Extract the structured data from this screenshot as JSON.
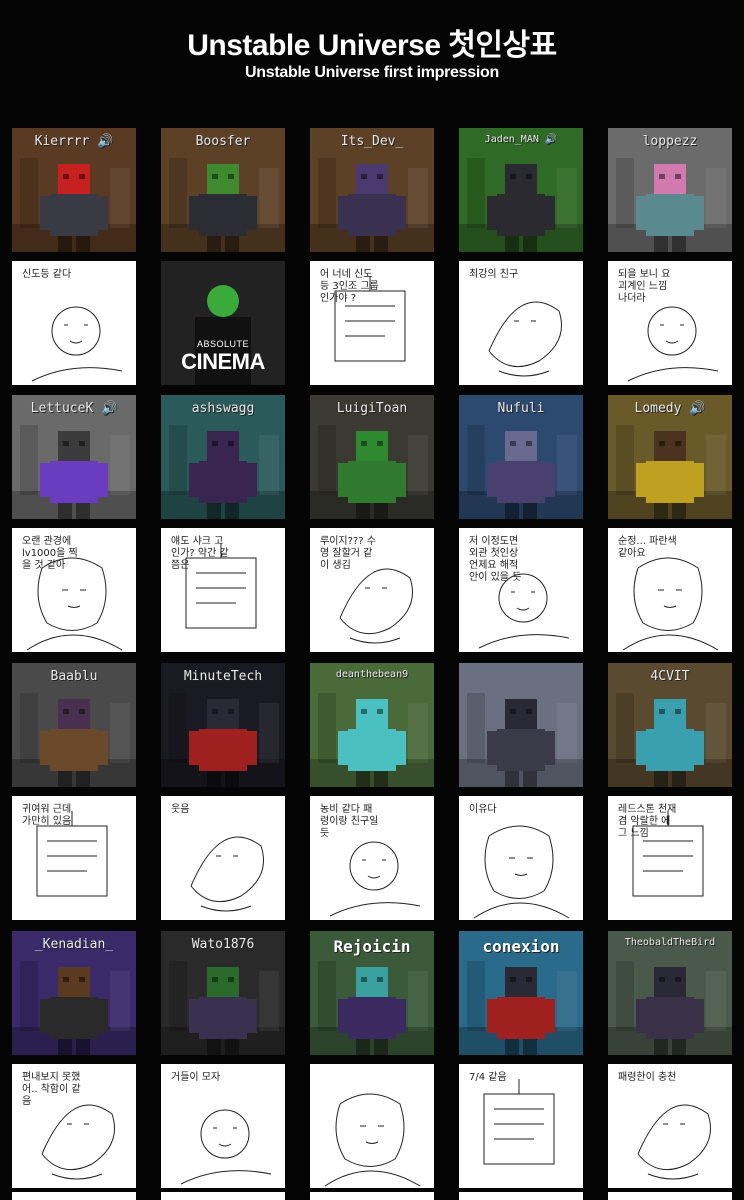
{
  "header": {
    "title": "Unstable Universe 첫인상표",
    "subtitle": "Unstable Universe first impression"
  },
  "rows": [
    {
      "shots": [
        {
          "name": "Kierrrr 🔊",
          "bg": "#5a3a22",
          "skin": "#c62020",
          "body": "#3a3a44"
        },
        {
          "name": "Boosfer",
          "bg": "#5c4126",
          "skin": "#3f8a2e",
          "body": "#2c2c34"
        },
        {
          "name": "Its_Dev_",
          "bg": "#5c4126",
          "skin": "#4a3a70",
          "body": "#3a3050"
        },
        {
          "name": "Jaden_MAN 🔊",
          "bg": "#2f6a26",
          "skin": "#2a2a30",
          "body": "#2a2a30"
        },
        {
          "name": "loppezz",
          "bg": "#6b6b6b",
          "skin": "#d07ab0",
          "body": "#5a8a90"
        }
      ],
      "sketches": [
        {
          "note": "신도등 같다"
        },
        {
          "note": "ABSOLUTE CINEMA",
          "cinema_top": "ABSOLUTE",
          "cinema_main": "CINEMA"
        },
        {
          "note": "어 너네 신도등 3인조 그룹인가야 ?"
        },
        {
          "note": "최강의 친구"
        },
        {
          "note": "되을 보니 요괴계인 느낌 나더라"
        }
      ]
    },
    {
      "shots": [
        {
          "name": "LettuceK 🔊",
          "bg": "#6a6a6a",
          "skin": "#3b3b3b",
          "body": "#6a3cc0"
        },
        {
          "name": "ashswagg",
          "bg": "#2a5a5a",
          "skin": "#3a2450",
          "body": "#3a2450"
        },
        {
          "name": "LuigiToan",
          "bg": "#3a3a32",
          "skin": "#2f8a2f",
          "body": "#2f7a2f"
        },
        {
          "name": "Nufuli",
          "bg": "#2c4a70",
          "skin": "#6a6a90",
          "body": "#4a4070"
        },
        {
          "name": "Lomedy 🔊",
          "bg": "#6a5a2a",
          "skin": "#4a3420",
          "body": "#c0a020"
        }
      ],
      "sketches": [
        {
          "note": "오랜 관경에 lv1000을 찍을 것 같아"
        },
        {
          "note": "얘도 샤크 고인가? 약간 같 쯤은"
        },
        {
          "note": "루이지??? 수영 잘할거 같이 생김"
        },
        {
          "note": "저 이정도면 외관 첫인상 언제요 해적 안이 있을 듯"
        },
        {
          "note": "순정... 파란색같아요"
        }
      ]
    },
    {
      "shots": [
        {
          "name": "Baablu",
          "bg": "#4a4a4a",
          "skin": "#4a3050",
          "body": "#6a4a2a"
        },
        {
          "name": "MinuteTech",
          "bg": "#1a1a22",
          "skin": "#2a2a36",
          "body": "#a02020"
        },
        {
          "name": "deanthebean9",
          "bg": "#4a6a3a",
          "skin": "#4ac0c0",
          "body": "#4ac0c0"
        },
        {
          "name": "",
          "bg": "#6a7080",
          "skin": "#2a2a36",
          "body": "#3a3a48"
        },
        {
          "name": "4CVIT",
          "bg": "#5a4a30",
          "skin": "#3aa0b0",
          "body": "#3aa0b0"
        }
      ],
      "sketches": [
        {
          "note": "귀여워 근데 가만히 있음"
        },
        {
          "note": "웃음"
        },
        {
          "note": "농비 같다 패령이랑 친구일 듯"
        },
        {
          "note": "이유다"
        },
        {
          "note": "레드스톤 천재 겸 악랄한 에그 느낌"
        }
      ]
    },
    {
      "shots": [
        {
          "name": "_Kenadian_",
          "bg": "#3a2a6a",
          "skin": "#5a3a20",
          "body": "#2a2a2a"
        },
        {
          "name": "Wato1876",
          "bg": "#2a2a2a",
          "skin": "#2a6a2a",
          "body": "#3a3050"
        },
        {
          "name": "Rejoicin",
          "bg": "#3a5a3a",
          "skin": "#3aa0a0",
          "body": "#3a2a60"
        },
        {
          "name": "conexion",
          "bg": "#2a6a8a",
          "skin": "#2a2a36",
          "body": "#a02020"
        },
        {
          "name": "TheobaldTheBird",
          "bg": "#4a5a4a",
          "skin": "#2a2a36",
          "body": "#3a3048"
        }
      ],
      "sketches": [
        {
          "note": "편내보지 못했어.. 착함이 같음"
        },
        {
          "note": "거들이 모자"
        },
        {
          "note": ""
        },
        {
          "note": "7/4 같음"
        },
        {
          "note": "패령한이 충천"
        }
      ]
    }
  ],
  "colors": {
    "page_bg": "#050505",
    "sketch_bg": "#ffffff"
  }
}
